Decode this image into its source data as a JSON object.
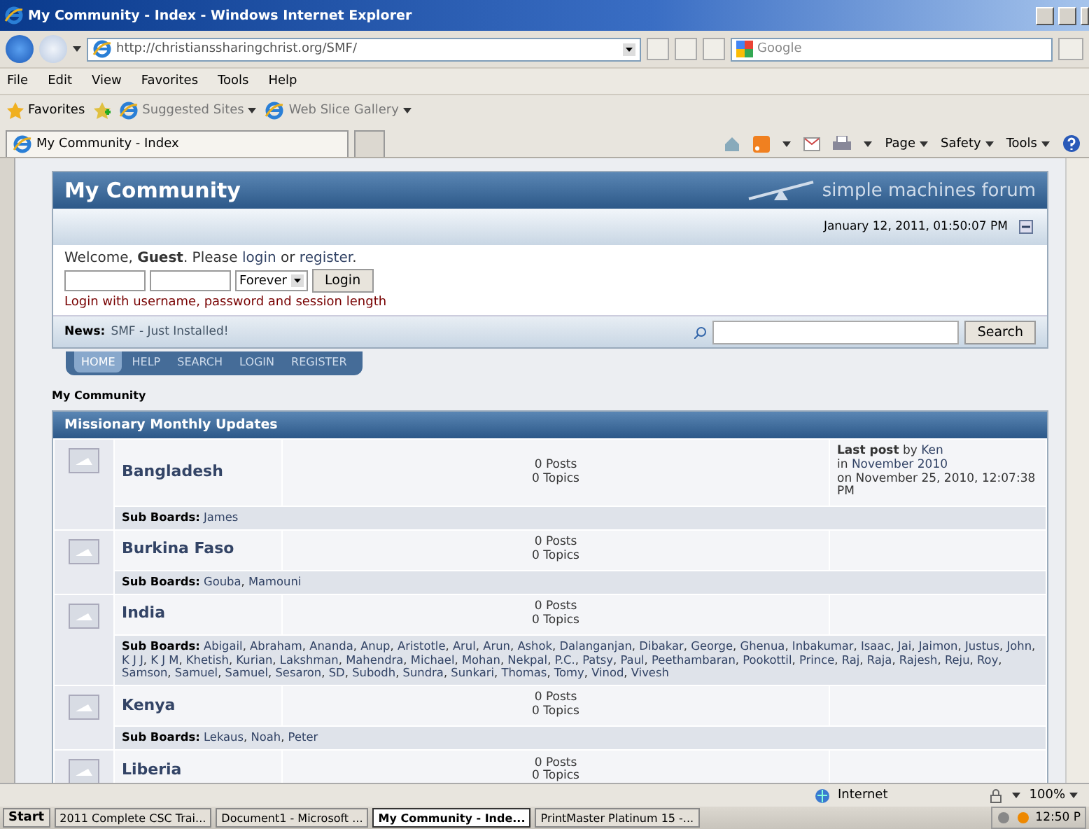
{
  "window": {
    "title": "My Community - Index - Windows Internet Explorer"
  },
  "address_bar": {
    "url": "http://christianssharingchrist.org/SMF/"
  },
  "search_box": {
    "placeholder": "Google"
  },
  "menu": [
    "File",
    "Edit",
    "View",
    "Favorites",
    "Tools",
    "Help"
  ],
  "favorites_bar": {
    "label": "Favorites",
    "links": [
      "Suggested Sites",
      "Web Slice Gallery"
    ]
  },
  "tabs": [
    {
      "label": "My Community - Index",
      "selected": true
    }
  ],
  "command_bar": [
    "Page",
    "Safety",
    "Tools"
  ],
  "forum": {
    "title": "My Community",
    "logo_text": "simple machines forum",
    "date": "January 12, 2011, 01:50:07 PM",
    "welcome": {
      "before": "Welcome, **Guest**. Please",
      "login_link": "login",
      "middle": "or",
      "register_link": "register",
      "end": "."
    },
    "login": {
      "session": "Forever",
      "button": "Login",
      "hint": "Login with username, password and session length"
    },
    "news": {
      "label": "News:",
      "text": "SMF - Just Installed!"
    },
    "search_button": "Search",
    "nav_tabs": [
      {
        "label": "HOME",
        "selected": true
      },
      {
        "label": "HELP",
        "selected": false
      },
      {
        "label": "SEARCH",
        "selected": false
      },
      {
        "label": "LOGIN",
        "selected": false
      },
      {
        "label": "REGISTER",
        "selected": false
      }
    ],
    "breadcrumb": "My Community",
    "category": "Missionary Monthly Updates",
    "boards": [
      {
        "name": "Bangladesh",
        "posts": "0 Posts",
        "topics": "0 Topics",
        "last_post": {
          "label": "Last post",
          "by": "by",
          "author": "Ken",
          "in": "in",
          "board": "November 2010",
          "date": "on November 25, 2010, 12:07:38 PM"
        },
        "sub_label": "Sub Boards:",
        "sub_boards": [
          "James"
        ]
      },
      {
        "name": "Burkina Faso",
        "posts": "0 Posts",
        "topics": "0 Topics",
        "sub_label": "Sub Boards:",
        "separator": ",",
        "sub_boards": [
          "Gouba",
          "Mamouni"
        ]
      },
      {
        "name": "India",
        "posts": "0 Posts",
        "topics": "0 Topics",
        "sub_label": "Sub Boards:",
        "separator": ",",
        "sub_boards": [
          "Abigail",
          "Abraham",
          "Ananda",
          "Anup",
          "Aristotle",
          "Arul",
          "Arun",
          "Ashok",
          "Dalanganjan",
          "Dibakar",
          "George",
          "Ghenua",
          "Inbakumar",
          "Isaac",
          "Jai",
          "Jaimon",
          "Justus",
          "John",
          "K J J",
          "K J M",
          "Khetish",
          "Kurian",
          "Lakshman",
          "Mahendra",
          "Michael",
          "Mohan",
          "Nekpal",
          "P.C.",
          "Patsy",
          "Paul",
          "Peethambaran",
          "Pookottil",
          "Prince",
          "Raj",
          "Raja",
          "Rajesh",
          "Reju",
          "Roy",
          "Samson",
          "Samuel",
          "Samuel",
          "Sesaron",
          "SD",
          "Subodh",
          "Sundra",
          "Sunkari",
          "Thomas",
          "Tomy",
          "Vinod",
          "Vivesh"
        ]
      },
      {
        "name": "Kenya",
        "posts": "0 Posts",
        "topics": "0 Topics",
        "sub_label": "Sub Boards:",
        "separator": ",",
        "sub_boards": [
          "Lekaus",
          "Noah",
          "Peter"
        ]
      },
      {
        "name": "Liberia",
        "posts": "0 Posts",
        "topics": "0 Topics"
      }
    ]
  },
  "status_bar": {
    "zone": "Internet",
    "zoom": "100%"
  },
  "taskbar": {
    "start": "Start",
    "tasks": [
      {
        "label": "2011 Complete CSC Trai...",
        "selected": false
      },
      {
        "label": "Document1 - Microsoft ...",
        "selected": false
      },
      {
        "label": "My Community - Inde...",
        "selected": true
      },
      {
        "label": "PrintMaster Platinum 15 -...",
        "selected": false
      }
    ],
    "clock": "12:50 P"
  }
}
